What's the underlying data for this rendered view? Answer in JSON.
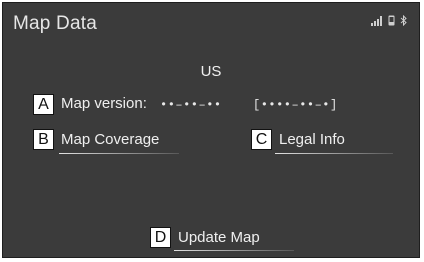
{
  "screen": {
    "title": "Map Data"
  },
  "status_icons": [
    "signal-bars-icon",
    "phone-icon",
    "bluetooth-icon"
  ],
  "region": "US",
  "callouts": {
    "a": "A",
    "b": "B",
    "c": "C",
    "d": "D"
  },
  "map_version": {
    "label": "Map version:",
    "value": "••–••–••",
    "bracket_value": "[••••–••–•]"
  },
  "buttons": {
    "map_coverage": "Map Coverage",
    "legal_info": "Legal Info",
    "update_map": "Update Map"
  },
  "colors": {
    "screen_bg": "#3b3b3b",
    "text": "#efefef",
    "callout_bg": "#ffffff"
  }
}
